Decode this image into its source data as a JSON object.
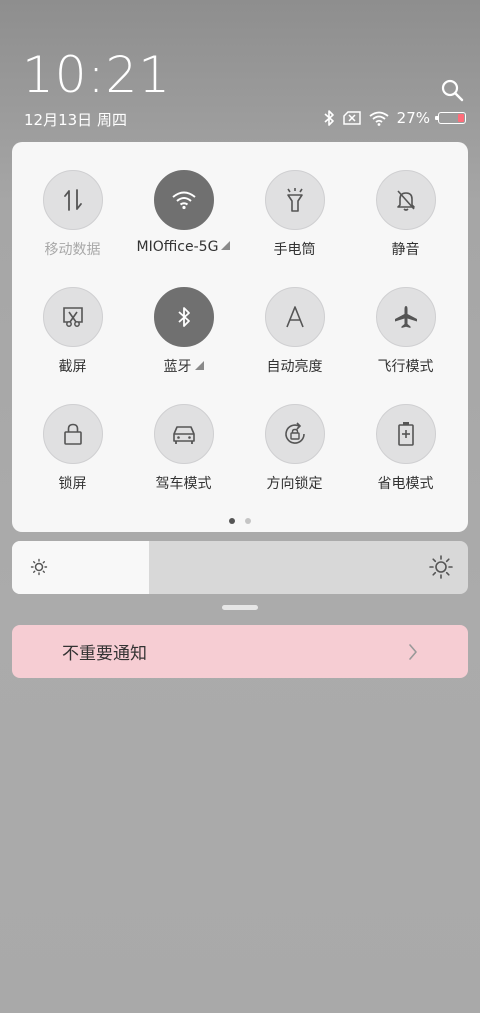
{
  "statusbar": {
    "time": "10:21",
    "date": "12月13日 周四",
    "battery_percent": "27%",
    "battery_level": 0.27,
    "battery_color": "#ff6d7a"
  },
  "icons": [
    "search-icon",
    "bluetooth-icon",
    "no-sim-icon",
    "wifi-icon",
    "battery-icon"
  ],
  "quick_settings": [
    {
      "label": "移动数据",
      "icon": "mobile-data-icon",
      "active": false,
      "dim": true
    },
    {
      "label": "MIOffice-5G",
      "icon": "wifi-icon",
      "active": true,
      "expandable": true
    },
    {
      "label": "手电筒",
      "icon": "flashlight-icon",
      "active": false
    },
    {
      "label": "静音",
      "icon": "mute-bell-icon",
      "active": false
    },
    {
      "label": "截屏",
      "icon": "screenshot-icon",
      "active": false
    },
    {
      "label": "蓝牙",
      "icon": "bluetooth-icon",
      "active": true,
      "expandable": true
    },
    {
      "label": "自动亮度",
      "icon": "auto-brightness-icon",
      "active": false
    },
    {
      "label": "飞行模式",
      "icon": "airplane-icon",
      "active": false
    },
    {
      "label": "锁屏",
      "icon": "lock-icon",
      "active": false
    },
    {
      "label": "驾车模式",
      "icon": "car-icon",
      "active": false
    },
    {
      "label": "方向锁定",
      "icon": "rotation-lock-icon",
      "active": false
    },
    {
      "label": "省电模式",
      "icon": "battery-saver-icon",
      "active": false
    }
  ],
  "pager": {
    "pages": 2,
    "current": 1
  },
  "brightness": {
    "level": 0.3
  },
  "notification": {
    "label": "不重要通知"
  },
  "colors": {
    "active_tile": "#707070",
    "panel_bg": "#f7f7f7",
    "notification_bg": "#f6cdd3"
  }
}
